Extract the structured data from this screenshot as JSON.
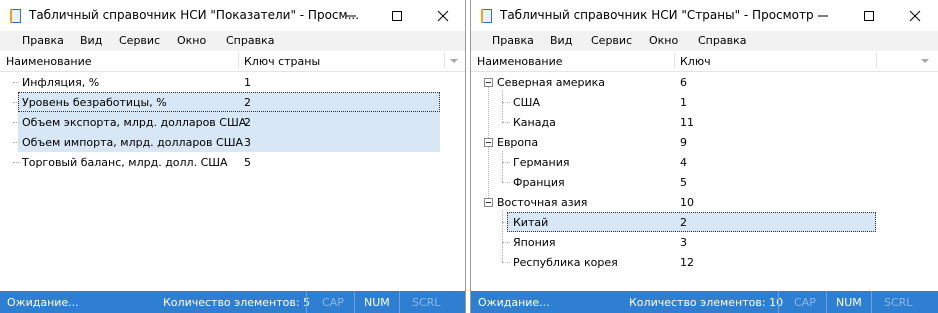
{
  "left": {
    "title": "Табличный справочник НСИ \"Показатели\" - Просм...",
    "menu": [
      "Правка",
      "Вид",
      "Сервис",
      "Окно",
      "Справка"
    ],
    "columns": [
      "Наименование",
      "Ключ страны"
    ],
    "rows": [
      {
        "name": "Инфляция, %",
        "key": "1"
      },
      {
        "name": "Уровень безработицы, %",
        "key": "2"
      },
      {
        "name": "Объем экспорта, млрд. долларов США",
        "key": "2"
      },
      {
        "name": "Объем импорта, млрд. долларов США",
        "key": "3"
      },
      {
        "name": "Торговый баланс, млрд. долл. США",
        "key": "5"
      }
    ],
    "status": {
      "state": "Ожидание...",
      "count": "Количество элементов: 5",
      "cap": "CAP",
      "num": "NUM",
      "scrl": "SCRL"
    }
  },
  "right": {
    "title": "Табличный справочник НСИ \"Страны\" - Просмотр",
    "menu": [
      "Правка",
      "Вид",
      "Сервис",
      "Окно",
      "Справка"
    ],
    "columns": [
      "Наименование",
      "Ключ"
    ],
    "rows": [
      {
        "name": "Северная америка",
        "key": "6"
      },
      {
        "name": "США",
        "key": "1"
      },
      {
        "name": "Канада",
        "key": "11"
      },
      {
        "name": "Европа",
        "key": "9"
      },
      {
        "name": "Германия",
        "key": "4"
      },
      {
        "name": "Франция",
        "key": "5"
      },
      {
        "name": "Восточная азия",
        "key": "10"
      },
      {
        "name": "Китай",
        "key": "2"
      },
      {
        "name": "Япония",
        "key": "3"
      },
      {
        "name": "Республика корея",
        "key": "12"
      }
    ],
    "status": {
      "state": "Ожидание...",
      "count": "Количество элементов: 10",
      "cap": "CAP",
      "num": "NUM",
      "scrl": "SCRL"
    }
  },
  "colors": {
    "statusbar": "#2e7fd1",
    "selection": "#d7e7f5",
    "menubar": "#f2f2f2"
  }
}
